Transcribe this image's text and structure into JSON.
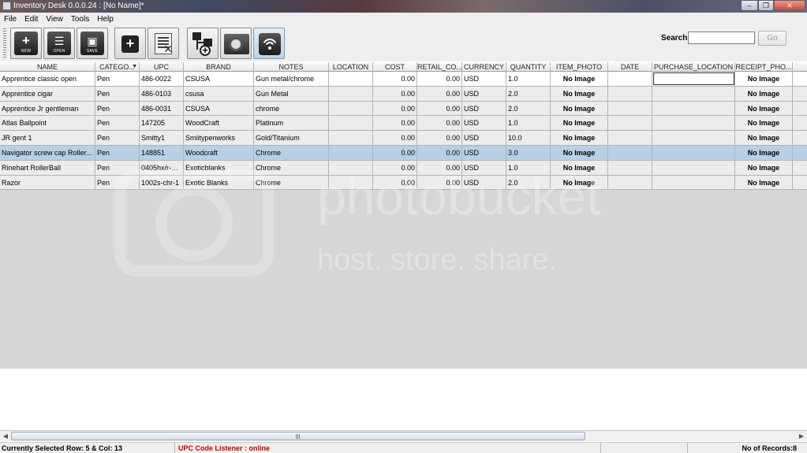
{
  "window": {
    "title": "Inventory Desk 0.0.0.24 : [No Name]*"
  },
  "menu": [
    "File",
    "Edit",
    "View",
    "Tools",
    "Help"
  ],
  "toolbar": {
    "new_label": "NEW",
    "open_label": "OPEN",
    "save_label": "SAVE"
  },
  "search": {
    "label": "Search",
    "value": "",
    "go_label": "Go"
  },
  "table": {
    "columns": [
      "NAME",
      "CATEGO...",
      "UPC",
      "BRAND",
      "NOTES",
      "LOCATION",
      "COST",
      "RETAIL_CO...",
      "CURRENCY",
      "QUANTITY",
      "ITEM_PHOTO",
      "DATE",
      "PURCHASE_LOCATION",
      "RECEIPT_PHO..."
    ],
    "rows": [
      [
        "Apprentice classic open",
        "Pen",
        "486-0022",
        "CSUSA",
        "Gun metal/chrome",
        "",
        "0.00",
        "0.00",
        "USD",
        "1.0",
        "No Image",
        "",
        "",
        "No Image"
      ],
      [
        "Apprentice cigar",
        "Pen",
        "486-0103",
        "csusa",
        "Gun Metal",
        "",
        "0.00",
        "0.00",
        "USD",
        "2.0",
        "No Image",
        "",
        "",
        "No Image"
      ],
      [
        "Apprentice Jr gentleman",
        "Pen",
        "486-0031",
        "CSUSA",
        "chrome",
        "",
        "0.00",
        "0.00",
        "USD",
        "2.0",
        "No Image",
        "",
        "",
        "No Image"
      ],
      [
        "Atlas Ballpoint",
        "Pen",
        "147205",
        "WoodCraft",
        "Platinum",
        "",
        "0.00",
        "0.00",
        "USD",
        "1.0",
        "No Image",
        "",
        "",
        "No Image"
      ],
      [
        "JR gent 1",
        "Pen",
        "Smitty1",
        "Smiitypenworks",
        "Gold/Titanium",
        "",
        "0.00",
        "0.00",
        "USD",
        "10.0",
        "No Image",
        "",
        "",
        "No Image"
      ],
      [
        "Navigator screw cap Roller...",
        "Pen",
        "148851",
        "Woodcraft",
        "Chrome",
        "",
        "0.00",
        "0.00",
        "USD",
        "3.0",
        "No Image",
        "",
        "",
        "No Image"
      ],
      [
        "Rinehart RollerBall",
        "Pen",
        "0405hx/r-6-...",
        "Exoticblanks",
        "Chrome",
        "",
        "0.00",
        "0.00",
        "USD",
        "1.0",
        "No Image",
        "",
        "",
        "No Image"
      ],
      [
        "Razor",
        "Pen",
        "1002s-chr-1",
        "Exotic Blanks",
        "Chrome",
        "",
        "0.00",
        "0.00",
        "USD",
        "2.0",
        "No Image",
        "",
        "",
        "No Image"
      ]
    ],
    "selected_row": 5
  },
  "watermark": {
    "line1": "photobucket",
    "line2": "host. store. share."
  },
  "status": {
    "selection": "Currently Selected Row: 5 & Col: 13",
    "upc_listener": "UPC Code Listener : online",
    "records": "No of Records:8"
  },
  "colors": {
    "selected_row": "#b8cfe5",
    "listener_status": "#c00000"
  }
}
